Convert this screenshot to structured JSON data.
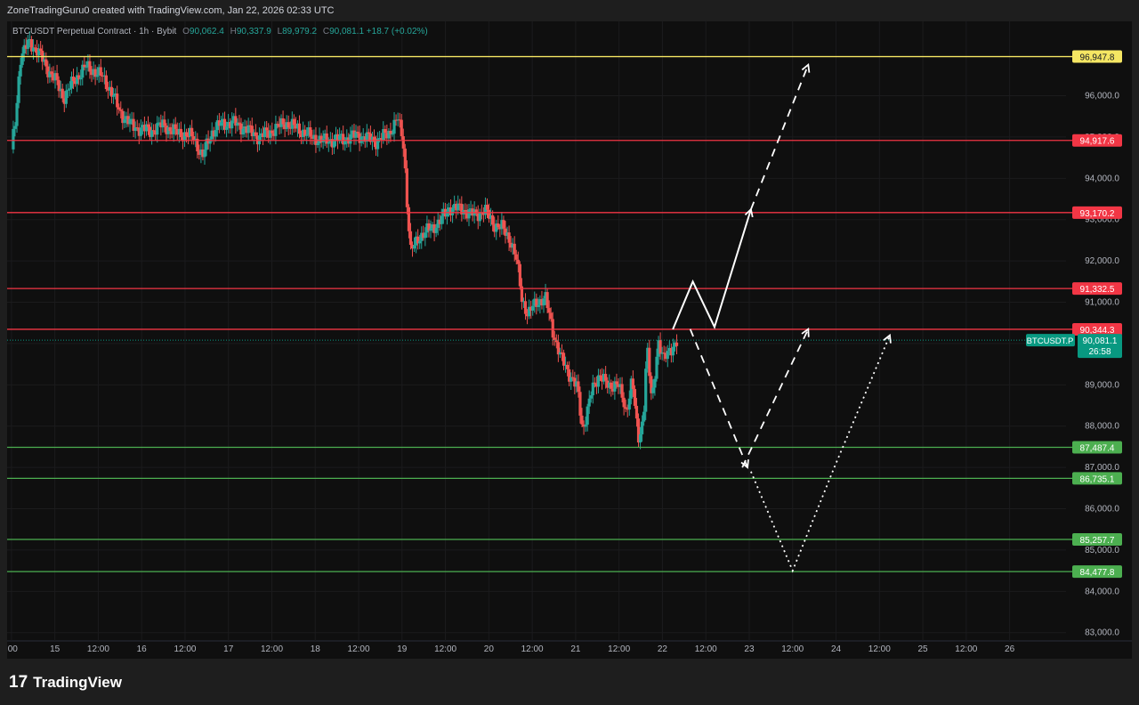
{
  "header": {
    "credit": "ZoneTradingGuru0 created with TradingView.com, Jan 22, 2026 02:33 UTC"
  },
  "legend": {
    "symbol": "BTCUSDT Perpetual Contract · 1h · Bybit",
    "o_label": "O",
    "o_value": "90,062.4",
    "h_label": "H",
    "h_value": "90,337.9",
    "l_label": "L",
    "l_value": "89,979.2",
    "c_label": "C",
    "c_value": "90,081.1",
    "change": "+18.7 (+0.02%)"
  },
  "colors": {
    "up": "#26a69a",
    "down": "#ef5350",
    "resistance": "#f23645",
    "support": "#4caf50",
    "top_line": "#f5e663",
    "current": "#089981",
    "projection": "#ffffff"
  },
  "chart_data": {
    "type": "line",
    "ylim": [
      82800,
      97800
    ],
    "xlim": [
      -0.05,
      12.15
    ],
    "y_ticks": [
      83000,
      84000,
      85000,
      86000,
      87000,
      88000,
      89000,
      90000,
      91000,
      92000,
      93000,
      94000,
      95000,
      96000
    ],
    "y_tick_labels": [
      "83,000.0",
      "84,000.0",
      "85,000.0",
      "86,000.0",
      "87,000.0",
      "88,000.0",
      "89,000.0",
      "90,000.0",
      "91,000.0",
      "92,000.0",
      "93,000.0",
      "94,000.0",
      "95,000.0",
      "96,000.0"
    ],
    "x_ticks": [
      {
        "x": 0.0,
        "label": ":00"
      },
      {
        "x": 0.5,
        "label": "15"
      },
      {
        "x": 1.0,
        "label": "12:00"
      },
      {
        "x": 1.5,
        "label": "16"
      },
      {
        "x": 2.0,
        "label": "12:00"
      },
      {
        "x": 2.5,
        "label": "17"
      },
      {
        "x": 3.0,
        "label": "12:00"
      },
      {
        "x": 3.5,
        "label": "18"
      },
      {
        "x": 4.0,
        "label": "12:00"
      },
      {
        "x": 4.5,
        "label": "19"
      },
      {
        "x": 5.0,
        "label": "12:00"
      },
      {
        "x": 5.5,
        "label": "20"
      },
      {
        "x": 6.0,
        "label": "12:00"
      },
      {
        "x": 6.5,
        "label": "21"
      },
      {
        "x": 7.0,
        "label": "12:00"
      },
      {
        "x": 7.5,
        "label": "22"
      },
      {
        "x": 8.0,
        "label": "12:00"
      },
      {
        "x": 8.5,
        "label": "23"
      },
      {
        "x": 9.0,
        "label": "12:00"
      },
      {
        "x": 9.5,
        "label": "24"
      },
      {
        "x": 10.0,
        "label": "12:00"
      },
      {
        "x": 10.5,
        "label": "25"
      },
      {
        "x": 11.0,
        "label": "12:00"
      },
      {
        "x": 11.5,
        "label": "26"
      }
    ],
    "levels": [
      {
        "value": 96947.8,
        "label": "96,947.8",
        "kind": "top"
      },
      {
        "value": 94917.6,
        "label": "94,917.6",
        "kind": "resistance"
      },
      {
        "value": 93170.2,
        "label": "93,170.2",
        "kind": "resistance"
      },
      {
        "value": 91332.5,
        "label": "91,332.5",
        "kind": "resistance"
      },
      {
        "value": 90344.3,
        "label": "90,344.3",
        "kind": "resistance"
      },
      {
        "value": 87487.4,
        "label": "87,487.4",
        "kind": "support"
      },
      {
        "value": 86735.1,
        "label": "86,735.1",
        "kind": "support"
      },
      {
        "value": 85257.7,
        "label": "85,257.7",
        "kind": "support"
      },
      {
        "value": 84477.8,
        "label": "84,477.8",
        "kind": "support"
      }
    ],
    "current_price": {
      "value": 90081.1,
      "symbol": "BTCUSDT.P",
      "price_label": "90,081.1",
      "countdown": "26:58"
    },
    "price_path": [
      [
        0.0,
        94700
      ],
      [
        0.05,
        95500
      ],
      [
        0.1,
        96900
      ],
      [
        0.2,
        97300
      ],
      [
        0.3,
        97100
      ],
      [
        0.4,
        96700
      ],
      [
        0.5,
        96400
      ],
      [
        0.6,
        95950
      ],
      [
        0.7,
        96300
      ],
      [
        0.85,
        96700
      ],
      [
        0.95,
        96600
      ],
      [
        1.05,
        96450
      ],
      [
        1.15,
        96100
      ],
      [
        1.25,
        95600
      ],
      [
        1.4,
        95250
      ],
      [
        1.6,
        95150
      ],
      [
        1.75,
        95300
      ],
      [
        1.85,
        95150
      ],
      [
        2.0,
        95050
      ],
      [
        2.1,
        95000
      ],
      [
        2.2,
        94500
      ],
      [
        2.3,
        95100
      ],
      [
        2.4,
        95300
      ],
      [
        2.55,
        95350
      ],
      [
        2.7,
        95200
      ],
      [
        2.85,
        95000
      ],
      [
        3.0,
        95150
      ],
      [
        3.15,
        95350
      ],
      [
        3.3,
        95200
      ],
      [
        3.45,
        95000
      ],
      [
        3.6,
        94900
      ],
      [
        3.8,
        94950
      ],
      [
        4.0,
        95050
      ],
      [
        4.2,
        94900
      ],
      [
        4.35,
        95100
      ],
      [
        4.45,
        95450
      ],
      [
        4.52,
        94800
      ],
      [
        4.56,
        93300
      ],
      [
        4.6,
        92200
      ],
      [
        4.7,
        92600
      ],
      [
        4.85,
        92800
      ],
      [
        4.95,
        93000
      ],
      [
        5.05,
        93300
      ],
      [
        5.2,
        93250
      ],
      [
        5.35,
        93100
      ],
      [
        5.45,
        93250
      ],
      [
        5.55,
        92900
      ],
      [
        5.65,
        92800
      ],
      [
        5.75,
        92500
      ],
      [
        5.82,
        92000
      ],
      [
        5.88,
        91100
      ],
      [
        5.95,
        90700
      ],
      [
        6.05,
        91000
      ],
      [
        6.15,
        91100
      ],
      [
        6.25,
        90200
      ],
      [
        6.32,
        89700
      ],
      [
        6.42,
        89300
      ],
      [
        6.52,
        88900
      ],
      [
        6.58,
        87900
      ],
      [
        6.68,
        88800
      ],
      [
        6.78,
        89300
      ],
      [
        6.88,
        88900
      ],
      [
        6.98,
        89100
      ],
      [
        7.08,
        88300
      ],
      [
        7.15,
        89200
      ],
      [
        7.22,
        87600
      ],
      [
        7.28,
        88200
      ],
      [
        7.32,
        90000
      ],
      [
        7.38,
        88500
      ],
      [
        7.45,
        90100
      ],
      [
        7.52,
        89600
      ],
      [
        7.58,
        89800
      ],
      [
        7.62,
        89950
      ],
      [
        7.67,
        90081
      ]
    ],
    "projections": [
      {
        "style": "solid",
        "points": [
          [
            7.62,
            90344
          ],
          [
            7.85,
            91500
          ],
          [
            8.1,
            90400
          ],
          [
            8.52,
            93250
          ]
        ]
      },
      {
        "style": "dashed",
        "points": [
          [
            8.52,
            93250
          ],
          [
            9.18,
            96750
          ]
        ]
      },
      {
        "style": "dashed",
        "points": [
          [
            7.82,
            90350
          ],
          [
            8.48,
            87000
          ]
        ]
      },
      {
        "style": "dashed",
        "points": [
          [
            8.42,
            87000
          ],
          [
            9.18,
            90350
          ]
        ]
      },
      {
        "style": "dotted",
        "points": [
          [
            8.52,
            86900
          ],
          [
            9.0,
            84500
          ],
          [
            9.48,
            87000
          ],
          [
            10.12,
            90200
          ]
        ]
      }
    ]
  },
  "footer": {
    "logo_glyph": "17",
    "brand": "TradingView"
  }
}
